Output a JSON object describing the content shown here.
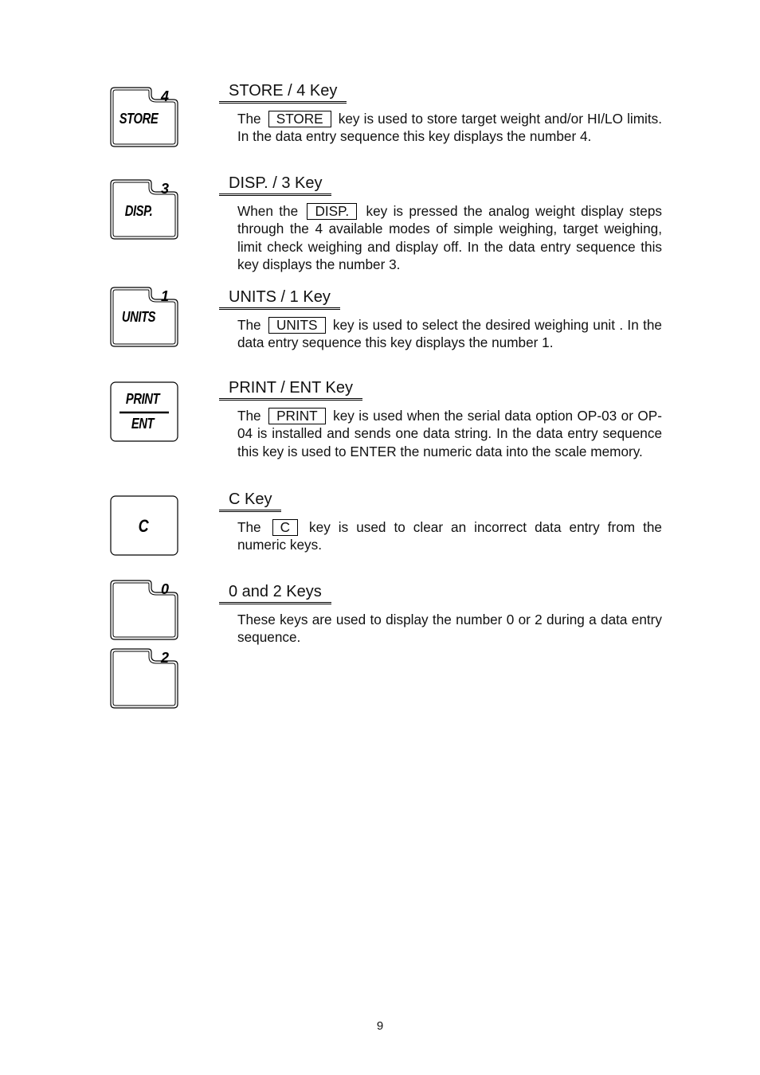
{
  "sections": [
    {
      "heading": "STORE / 4 Key",
      "key": {
        "label": "STORE",
        "number": "4"
      },
      "before": "The",
      "boxed": "STORE",
      "after": "key is used to store target weight and/or HI/LO limits. In the data entry sequence this key displays the number 4."
    },
    {
      "heading": "DISP. / 3 Key",
      "key": {
        "label": "DISP.",
        "number": "3"
      },
      "before": "When the",
      "boxed": "DISP.",
      "after": "key is pressed the analog weight display steps through the 4 available modes of simple weighing, target weighing, limit check weighing and display off. In the data entry sequence this key displays the number 3."
    },
    {
      "heading": "UNITS / 1 Key",
      "key": {
        "label": "UNITS",
        "number": "1"
      },
      "before": "The",
      "boxed": "UNITS",
      "after": "key is used to select the desired weighing unit . In the data entry sequence this key displays the number 1."
    },
    {
      "heading": "PRINT / ENT Key",
      "key": {
        "label_top": "PRINT",
        "label_bottom": "ENT"
      },
      "before": "The",
      "boxed": "PRINT",
      "after": "key is used when the serial data option OP-03 or OP-04 is installed and sends one data string. In the data entry sequence this key is used to ENTER the numeric data into the scale memory."
    },
    {
      "heading": "C Key",
      "key": {
        "label": "C"
      },
      "before": "The",
      "boxed": "C",
      "after": "key is used to clear an incorrect data entry from the numeric keys."
    },
    {
      "heading": "0 and 2 Keys",
      "keys": [
        {
          "number": "0"
        },
        {
          "number": "2"
        }
      ],
      "text": "These keys are used to display the number 0 or 2 during a data entry sequence."
    }
  ],
  "page_number": "9"
}
